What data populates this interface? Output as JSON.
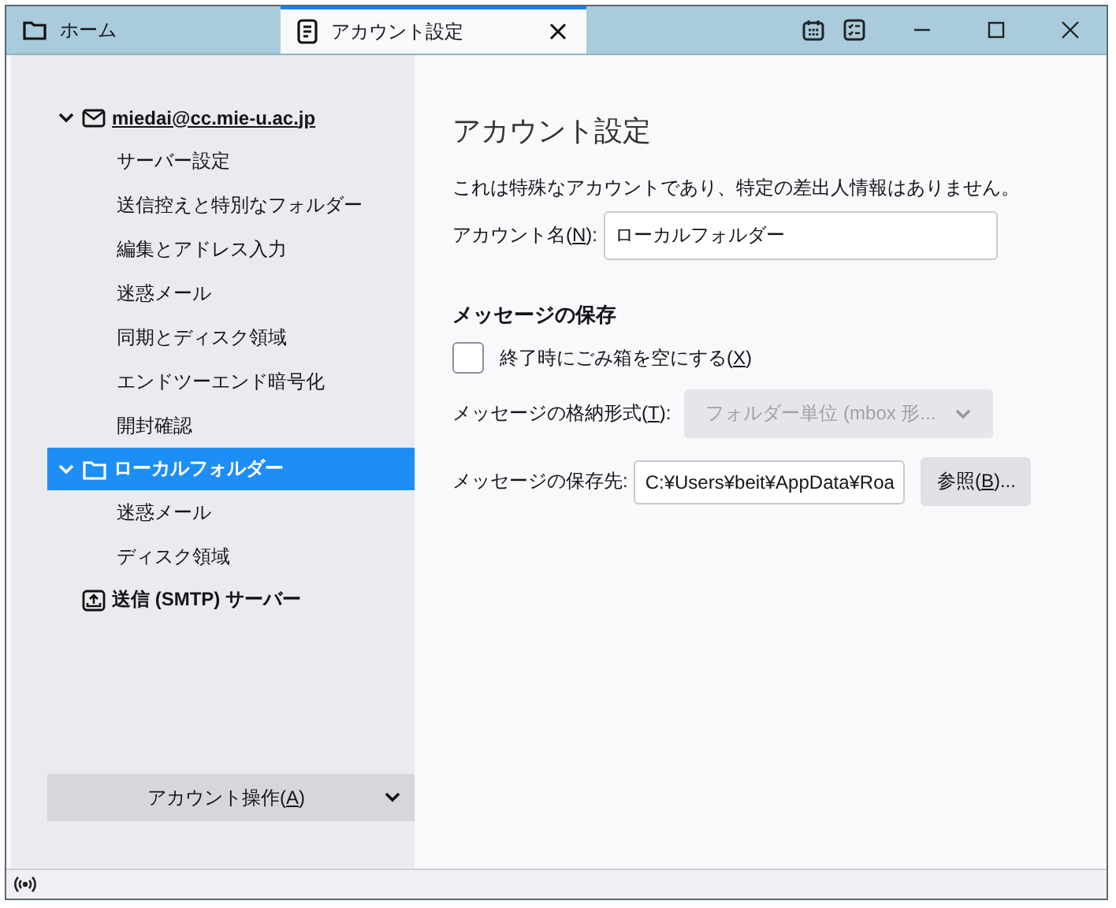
{
  "tabs": [
    {
      "label": "ホーム",
      "kind": "home",
      "selected": false,
      "closable": false
    },
    {
      "label": "アカウント設定",
      "kind": "settings",
      "selected": true,
      "closable": true
    }
  ],
  "sidebar": {
    "tree": [
      {
        "label": "miedai@cc.mie-u.ac.jp",
        "kind": "mail",
        "expanded": true,
        "selected": false,
        "hovered": true,
        "children": [
          {
            "label": "サーバー設定",
            "selected": false
          },
          {
            "label": "送信控えと特別なフォルダー",
            "selected": false
          },
          {
            "label": "編集とアドレス入力",
            "selected": false
          },
          {
            "label": "迷惑メール",
            "selected": false
          },
          {
            "label": "同期とディスク領域",
            "selected": false
          },
          {
            "label": "エンドツーエンド暗号化",
            "selected": false
          },
          {
            "label": "開封確認",
            "selected": false
          }
        ]
      },
      {
        "label": "ローカルフォルダー",
        "kind": "folder",
        "expanded": true,
        "selected": true,
        "hovered": false,
        "children": [
          {
            "label": "迷惑メール",
            "selected": false
          },
          {
            "label": "ディスク領域",
            "selected": false
          }
        ]
      },
      {
        "label": "送信 (SMTP) サーバー",
        "kind": "outgoing",
        "selected": false,
        "hovered": false
      }
    ],
    "account_actions": {
      "label": "アカウント操作(",
      "accesskey": "A",
      "label_end": ")"
    }
  },
  "main": {
    "title": "アカウント設定",
    "description": "これは特殊なアカウントであり、特定の差出人情報はありません。",
    "account_name": {
      "label": "アカウント名(",
      "accesskey": "N",
      "label_end": "):",
      "value": "ローカルフォルダー"
    },
    "section_heading": "メッセージの保存",
    "empty_trash": {
      "label": "終了時にごみ箱を空にする(",
      "accesskey": "X",
      "label_end": ")",
      "checked": false
    },
    "storage_format": {
      "label": "メッセージの格納形式(",
      "accesskey": "T",
      "label_end": "):",
      "value": "フォルダー単位 (mbox 形...",
      "disabled": true
    },
    "local_directory": {
      "label": "メッセージの保存先:",
      "value": "C:¥Users¥beit¥AppData¥Roa"
    },
    "browse_button": {
      "label": "参照(",
      "accesskey": "B",
      "label_end": ")..."
    }
  }
}
